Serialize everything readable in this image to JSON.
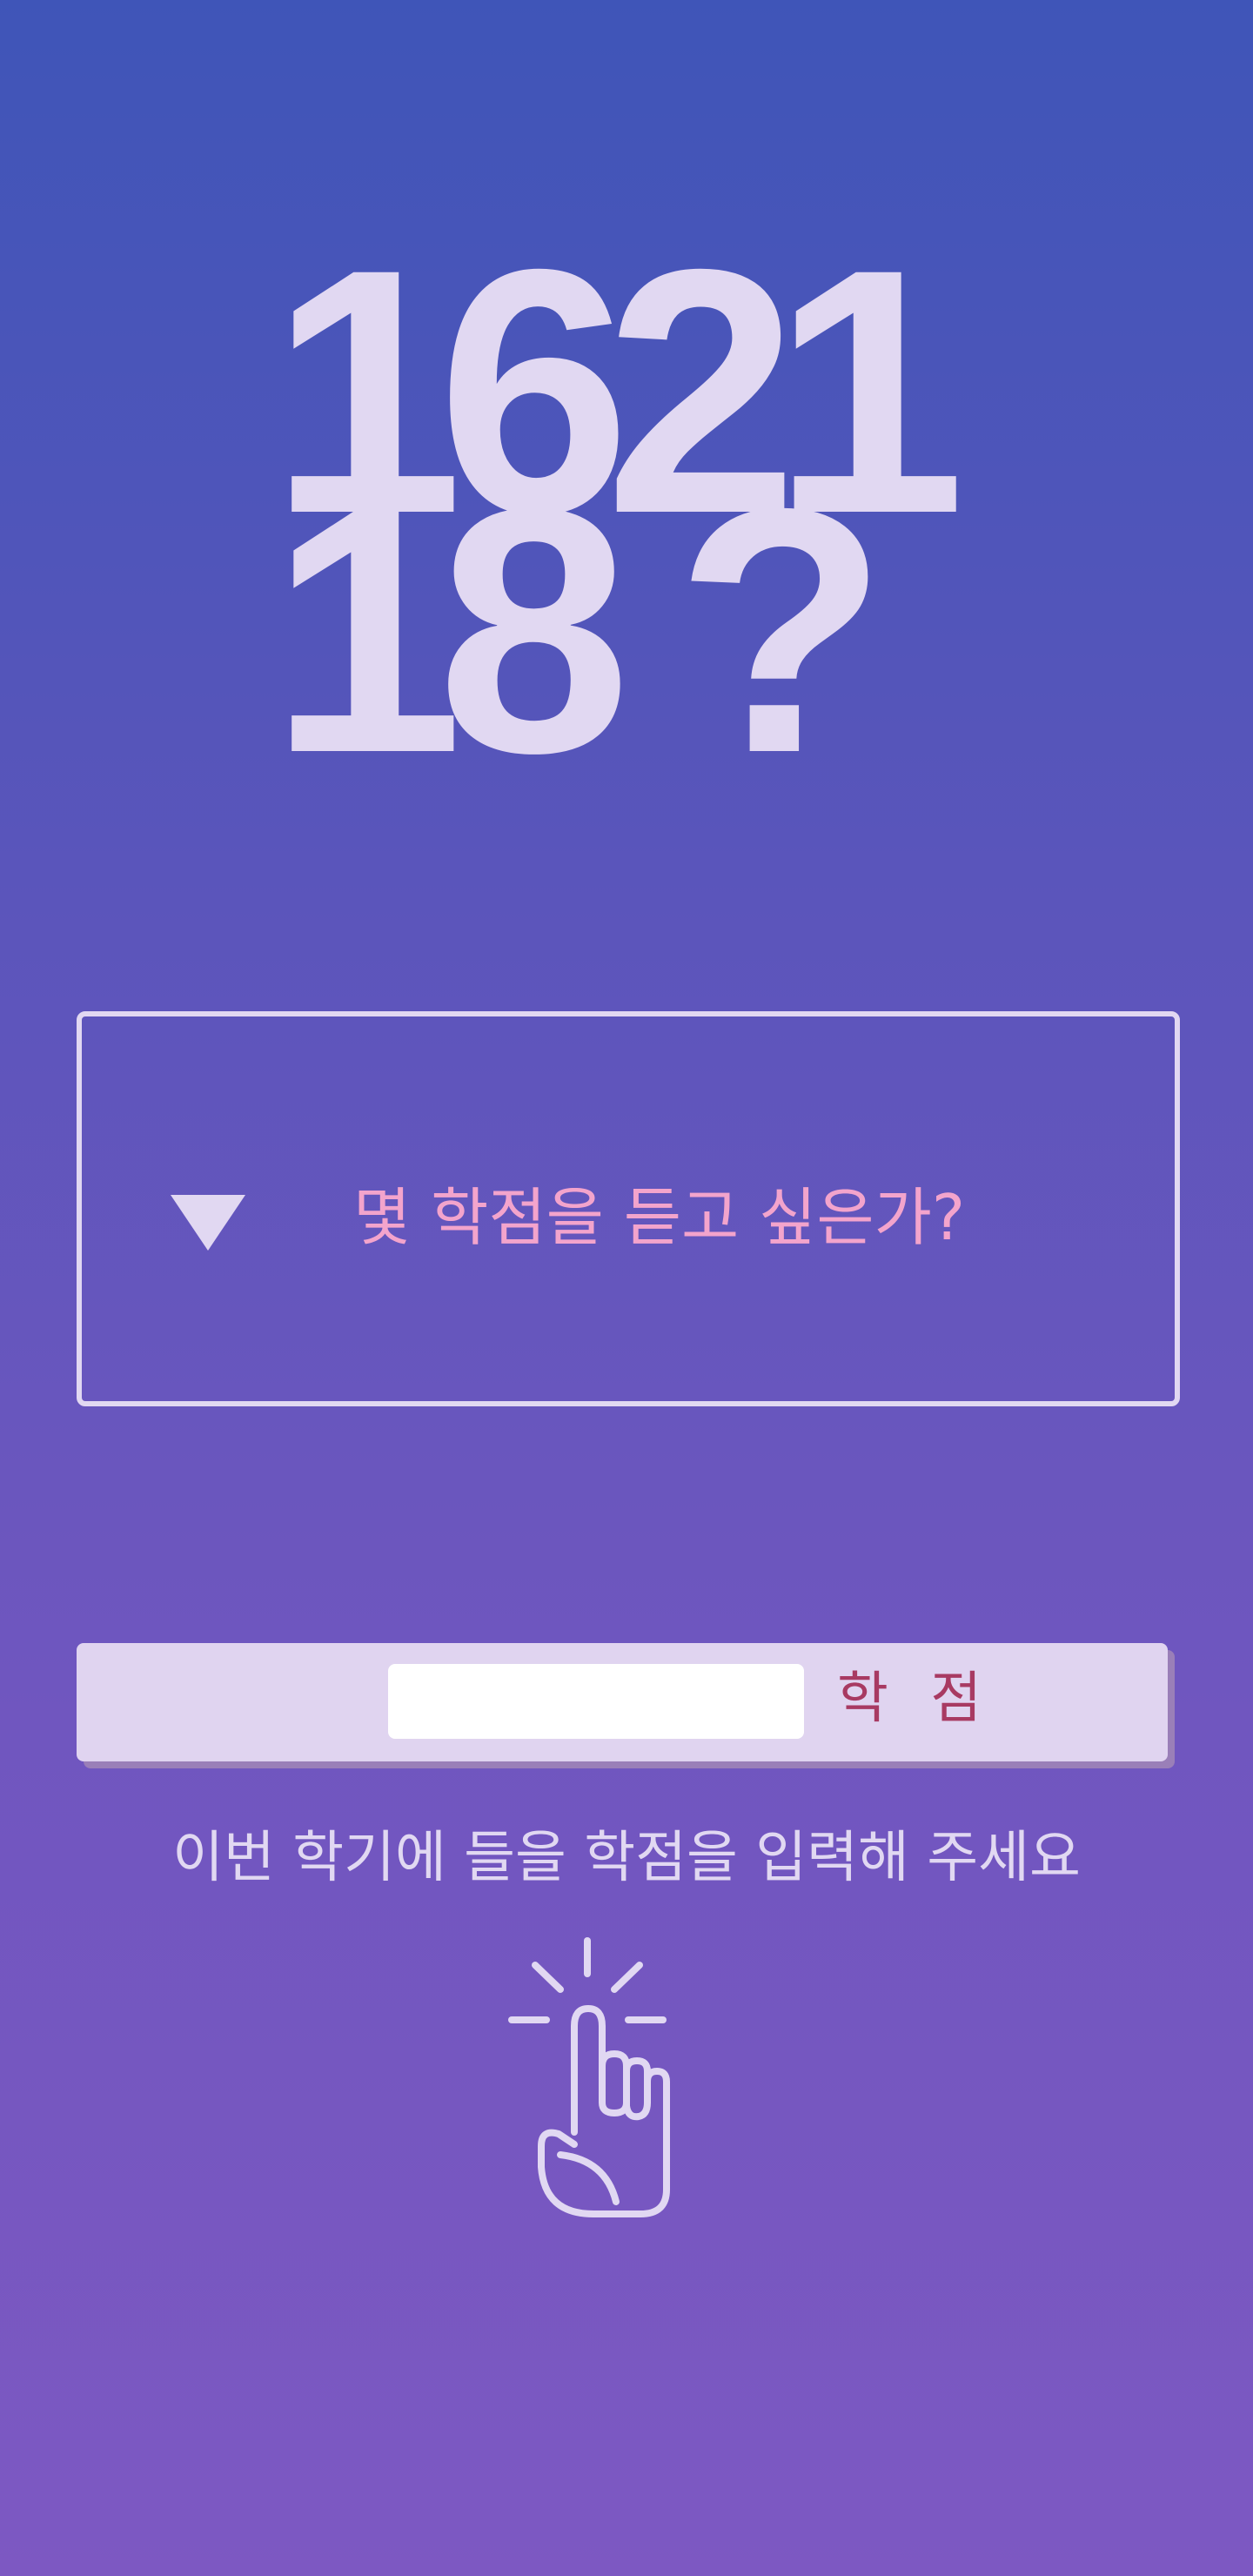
{
  "hero": {
    "line1": "1621",
    "line2": "18 ?"
  },
  "select": {
    "placeholder": "몇 학점을 듣고 싶은가?",
    "icon": "triangle-down-icon"
  },
  "credit_input": {
    "value": "",
    "unit_label": "학 점"
  },
  "hint": "이번 학기에 들을 학점을 입력해 주세요",
  "tap_icon": "tap-finger-icon",
  "colors": {
    "background_top": "#3f55b8",
    "background_bottom": "#7d58c2",
    "foreground": "#e1d8f2",
    "placeholder_pink": "#f3a4cc",
    "unit_red": "#a83a62"
  }
}
